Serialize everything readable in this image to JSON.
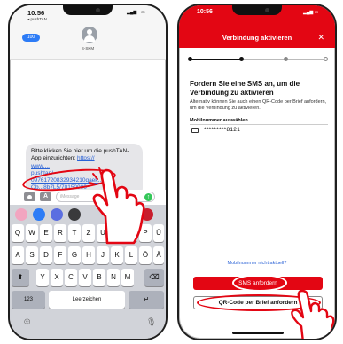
{
  "left_phone": {
    "status": {
      "time": "10:56",
      "carrier": "◂ pushTAN"
    },
    "header": {
      "back_count": "100",
      "contact": "S-SKM"
    },
    "message": {
      "text": "Bitte klicken Sie hier um die pushTAN-App einzurichten:",
      "link_parts": [
        "https://",
        "www.",
        "...",
        "pushtan/",
        "09761720832934210qaek...al",
        "Ob...8b7L5/70150000"
      ]
    },
    "input": {
      "placeholder": "iMessage"
    },
    "keyboard": {
      "row1": [
        "Q",
        "W",
        "E",
        "R",
        "T",
        "Z",
        "U",
        "I",
        "O",
        "P",
        "Ü"
      ],
      "row2": [
        "A",
        "S",
        "D",
        "F",
        "G",
        "H",
        "J",
        "K",
        "L",
        "Ö",
        "Ä"
      ],
      "row3": [
        "Y",
        "X",
        "C",
        "V",
        "B",
        "N",
        "M"
      ],
      "numbers_key": "123",
      "space_key": "Leerzeichen",
      "return_key": "↵",
      "shift_key": "⬆",
      "delete_key": "⌫",
      "emoji_key": "☺",
      "mic_key": "🎙"
    },
    "colors": {
      "link": "#2a62d6",
      "highlight": "#e30613",
      "send": "#34c759"
    }
  },
  "right_phone": {
    "status": {
      "time": "10:56"
    },
    "header": {
      "title": "Verbindung aktivieren",
      "close": "✕"
    },
    "headline": "Fordern Sie eine SMS an, um die Verbindung zu aktivieren",
    "subtext": "Alternativ können Sie auch einen QR-Code per Brief anfordern, um die Verbindung zu aktivieren.",
    "number_label": "Mobilnummer auswählen",
    "number_value": "*********8121",
    "link": "Mobilnummer nicht aktuell?",
    "primary_button": "SMS anfordern",
    "secondary_button": "QR-Code per Brief anfordern",
    "colors": {
      "brand": "#e30613",
      "link": "#2a62d6"
    }
  }
}
